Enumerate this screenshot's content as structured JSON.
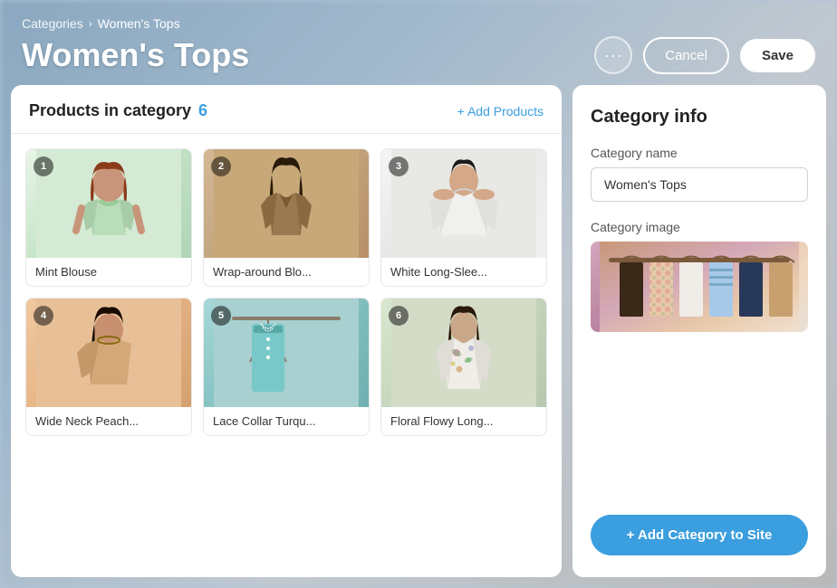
{
  "breadcrumb": {
    "parent_label": "Categories",
    "separator": "›",
    "current_label": "Women's Tops"
  },
  "header": {
    "title": "Women's Tops",
    "more_button_label": "···",
    "cancel_button_label": "Cancel",
    "save_button_label": "Save"
  },
  "products_panel": {
    "title": "Products in category",
    "count": "6",
    "add_link_label": "+ Add Products",
    "products": [
      {
        "id": 1,
        "number": "1",
        "name": "Mint Blouse",
        "color_class": "img-mint"
      },
      {
        "id": 2,
        "number": "2",
        "name": "Wrap-around Blo...",
        "color_class": "img-wrap"
      },
      {
        "id": 3,
        "number": "3",
        "name": "White Long-Slee...",
        "color_class": "img-white"
      },
      {
        "id": 4,
        "number": "4",
        "name": "Wide Neck Peach...",
        "color_class": "img-peach"
      },
      {
        "id": 5,
        "number": "5",
        "name": "Lace Collar Turqu...",
        "color_class": "img-turq"
      },
      {
        "id": 6,
        "number": "6",
        "name": "Floral Flowy Long...",
        "color_class": "img-floral"
      }
    ]
  },
  "category_panel": {
    "title": "Category info",
    "name_label": "Category name",
    "name_value": "Women's Tops",
    "image_label": "Category image",
    "add_button_label": "+ Add Category to Site"
  }
}
